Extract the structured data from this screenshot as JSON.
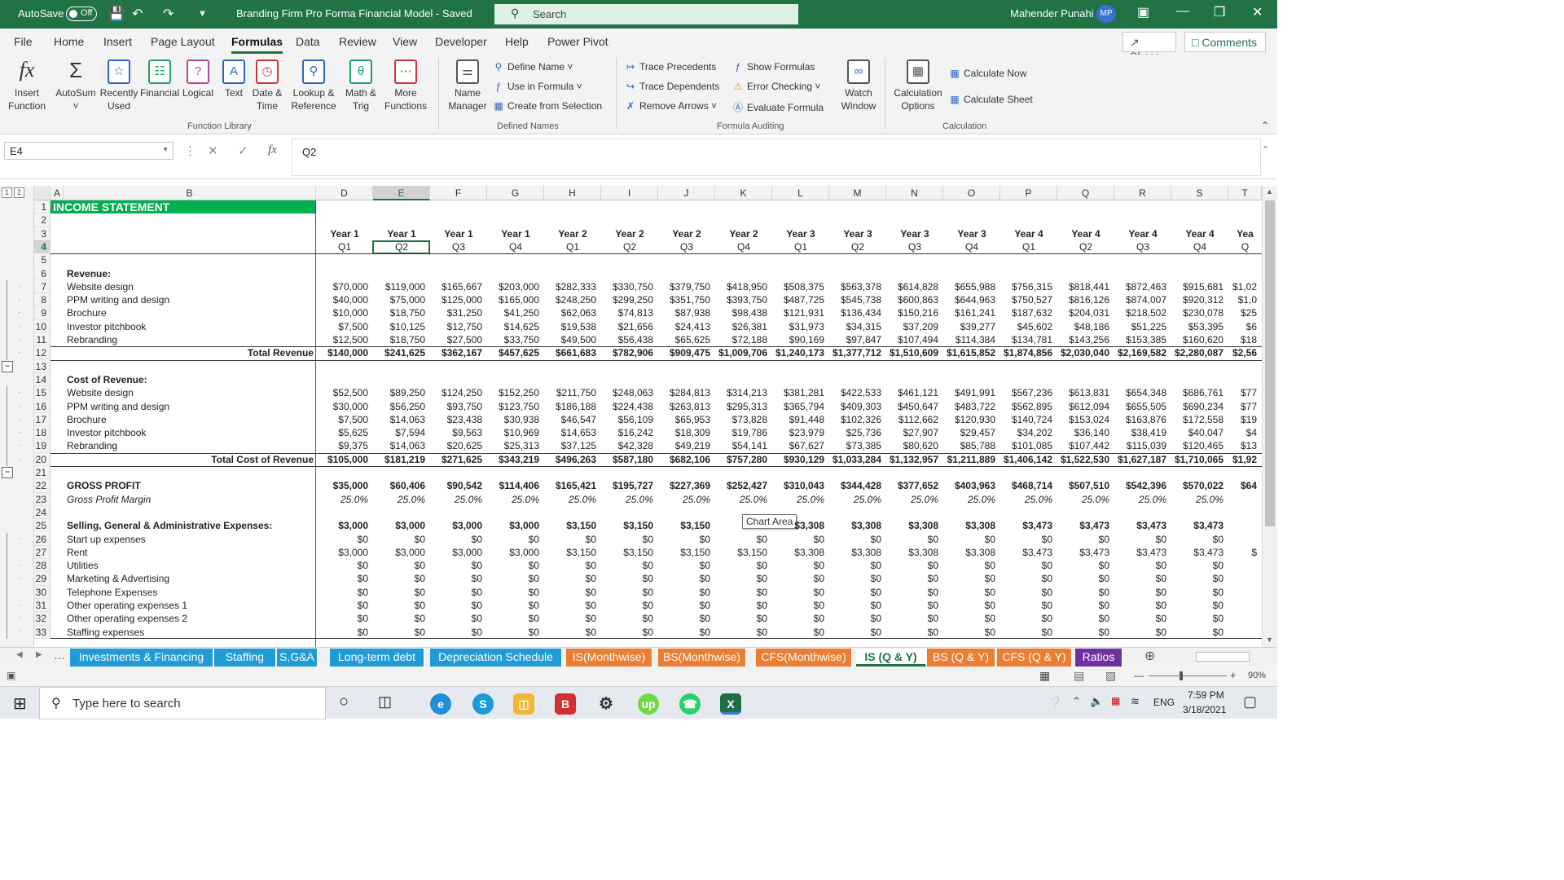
{
  "titlebar": {
    "autosave": "AutoSave",
    "autosave_state": "Off",
    "doc_title": "Branding Firm Pro Forma Financial Model  -  Saved",
    "search": "Search",
    "user": "Mahender Punahi",
    "initials": "MP"
  },
  "menu": [
    "File",
    "Home",
    "Insert",
    "Page Layout",
    "Formulas",
    "Data",
    "Review",
    "View",
    "Developer",
    "Help",
    "Power Pivot"
  ],
  "active_menu": "Formulas",
  "share": "Share",
  "comments": "Comments",
  "ribbon": {
    "insert_function": "Insert Function",
    "autosum": "AutoSum",
    "recently_used": "Recently Used",
    "financial": "Financial",
    "logical": "Logical",
    "text": "Text",
    "date_time": "Date & Time",
    "lookup": "Lookup & Reference",
    "math": "Math & Trig",
    "more": "More Functions",
    "name_manager": "Name Manager",
    "define_name": "Define Name",
    "use_in_formula": "Use in Formula",
    "create_from_selection": "Create from Selection",
    "trace_precedents": "Trace Precedents",
    "trace_dependents": "Trace Dependents",
    "remove_arrows": "Remove Arrows",
    "show_formulas": "Show Formulas",
    "error_checking": "Error Checking",
    "evaluate_formula": "Evaluate Formula",
    "watch_window": "Watch Window",
    "calc_options": "Calculation Options",
    "calc_now": "Calculate Now",
    "calc_sheet": "Calculate Sheet",
    "group_function_library": "Function Library",
    "group_defined_names": "Defined Names",
    "group_formula_auditing": "Formula Auditing",
    "group_calculation": "Calculation"
  },
  "formula_bar": {
    "name_box": "E4",
    "content": "Q2"
  },
  "columns": [
    "A",
    "B",
    "D",
    "E",
    "F",
    "G",
    "H",
    "I",
    "J",
    "K",
    "L",
    "M",
    "N",
    "O",
    "P",
    "Q",
    "R",
    "S",
    "T"
  ],
  "selected_column": "E",
  "outline_levels": [
    "1",
    "2"
  ],
  "sheet": {
    "title": "INCOME STATEMENT",
    "years": [
      "Year 1",
      "Year 1",
      "Year 1",
      "Year 1",
      "Year 2",
      "Year 2",
      "Year 2",
      "Year 2",
      "Year 3",
      "Year 3",
      "Year 3",
      "Year 3",
      "Year 4",
      "Year 4",
      "Year 4",
      "Year 4",
      "Yea"
    ],
    "quarters": [
      "Q1",
      "Q2",
      "Q3",
      "Q4",
      "Q1",
      "Q2",
      "Q3",
      "Q4",
      "Q1",
      "Q2",
      "Q3",
      "Q4",
      "Q1",
      "Q2",
      "Q3",
      "Q4",
      "Q"
    ],
    "rows": [
      {
        "r": "1"
      },
      {
        "r": "2"
      },
      {
        "r": "3"
      },
      {
        "r": "4"
      },
      {
        "r": "5"
      },
      {
        "r": "6",
        "label": "Revenue:",
        "style": "b"
      },
      {
        "r": "7",
        "label": "Website design",
        "vals": [
          "$70,000",
          "$119,000",
          "$165,667",
          "$203,000",
          "$282,333",
          "$330,750",
          "$379,750",
          "$418,950",
          "$508,375",
          "$563,378",
          "$614,828",
          "$655,988",
          "$756,315",
          "$818,441",
          "$872,463",
          "$915,681",
          "$1,02"
        ]
      },
      {
        "r": "8",
        "label": "PPM writing and design",
        "vals": [
          "$40,000",
          "$75,000",
          "$125,000",
          "$165,000",
          "$248,250",
          "$299,250",
          "$351,750",
          "$393,750",
          "$487,725",
          "$545,738",
          "$600,863",
          "$644,963",
          "$750,527",
          "$816,126",
          "$874,007",
          "$920,312",
          "$1,0"
        ]
      },
      {
        "r": "9",
        "label": "Brochure",
        "vals": [
          "$10,000",
          "$18,750",
          "$31,250",
          "$41,250",
          "$62,063",
          "$74,813",
          "$87,938",
          "$98,438",
          "$121,931",
          "$136,434",
          "$150,216",
          "$161,241",
          "$187,632",
          "$204,031",
          "$218,502",
          "$230,078",
          "$25"
        ]
      },
      {
        "r": "10",
        "label": "Investor pitchbook",
        "vals": [
          "$7,500",
          "$10,125",
          "$12,750",
          "$14,625",
          "$19,538",
          "$21,656",
          "$24,413",
          "$26,381",
          "$31,973",
          "$34,315",
          "$37,209",
          "$39,277",
          "$45,602",
          "$48,186",
          "$51,225",
          "$53,395",
          "$6"
        ]
      },
      {
        "r": "11",
        "label": "Rebranding",
        "vals": [
          "$12,500",
          "$18,750",
          "$27,500",
          "$33,750",
          "$49,500",
          "$56,438",
          "$65,625",
          "$72,188",
          "$90,169",
          "$97,847",
          "$107,494",
          "$114,384",
          "$134,781",
          "$143,256",
          "$153,385",
          "$160,620",
          "$18"
        ]
      },
      {
        "r": "12",
        "label": "Total Revenue",
        "style": "total",
        "vals": [
          "$140,000",
          "$241,625",
          "$362,167",
          "$457,625",
          "$661,683",
          "$782,906",
          "$909,475",
          "$1,009,706",
          "$1,240,173",
          "$1,377,712",
          "$1,510,609",
          "$1,615,852",
          "$1,874,856",
          "$2,030,040",
          "$2,169,582",
          "$2,280,087",
          "$2,56"
        ]
      },
      {
        "r": "13"
      },
      {
        "r": "14",
        "label": "Cost of Revenue:",
        "style": "b"
      },
      {
        "r": "15",
        "label": "Website design",
        "vals": [
          "$52,500",
          "$89,250",
          "$124,250",
          "$152,250",
          "$211,750",
          "$248,063",
          "$284,813",
          "$314,213",
          "$381,281",
          "$422,533",
          "$461,121",
          "$491,991",
          "$567,236",
          "$613,831",
          "$654,348",
          "$686,761",
          "$77"
        ]
      },
      {
        "r": "16",
        "label": "PPM writing and design",
        "vals": [
          "$30,000",
          "$56,250",
          "$93,750",
          "$123,750",
          "$186,188",
          "$224,438",
          "$263,813",
          "$295,313",
          "$365,794",
          "$409,303",
          "$450,647",
          "$483,722",
          "$562,895",
          "$612,094",
          "$655,505",
          "$690,234",
          "$77"
        ]
      },
      {
        "r": "17",
        "label": "Brochure",
        "vals": [
          "$7,500",
          "$14,063",
          "$23,438",
          "$30,938",
          "$46,547",
          "$56,109",
          "$65,953",
          "$73,828",
          "$91,448",
          "$102,326",
          "$112,662",
          "$120,930",
          "$140,724",
          "$153,024",
          "$163,876",
          "$172,558",
          "$19"
        ]
      },
      {
        "r": "18",
        "label": "Investor pitchbook",
        "vals": [
          "$5,625",
          "$7,594",
          "$9,563",
          "$10,969",
          "$14,653",
          "$16,242",
          "$18,309",
          "$19,786",
          "$23,979",
          "$25,736",
          "$27,907",
          "$29,457",
          "$34,202",
          "$36,140",
          "$38,419",
          "$40,047",
          "$4"
        ]
      },
      {
        "r": "19",
        "label": "Rebranding",
        "vals": [
          "$9,375",
          "$14,063",
          "$20,625",
          "$25,313",
          "$37,125",
          "$42,328",
          "$49,219",
          "$54,141",
          "$67,627",
          "$73,385",
          "$80,620",
          "$85,788",
          "$101,085",
          "$107,442",
          "$115,039",
          "$120,465",
          "$13"
        ]
      },
      {
        "r": "20",
        "label": "Total Cost of Revenue",
        "style": "total",
        "vals": [
          "$105,000",
          "$181,219",
          "$271,625",
          "$343,219",
          "$496,263",
          "$587,180",
          "$682,106",
          "$757,280",
          "$930,129",
          "$1,033,284",
          "$1,132,957",
          "$1,211,889",
          "$1,406,142",
          "$1,522,530",
          "$1,627,187",
          "$1,710,065",
          "$1,92"
        ]
      },
      {
        "r": "21"
      },
      {
        "r": "22",
        "label": "GROSS PROFIT",
        "style": "b",
        "vals": [
          "$35,000",
          "$60,406",
          "$90,542",
          "$114,406",
          "$165,421",
          "$195,727",
          "$227,369",
          "$252,427",
          "$310,043",
          "$344,428",
          "$377,652",
          "$403,963",
          "$468,714",
          "$507,510",
          "$542,396",
          "$570,022",
          "$64"
        ]
      },
      {
        "r": "23",
        "label": "Gross Profit Margin",
        "style": "i",
        "vals": [
          "25.0%",
          "25.0%",
          "25.0%",
          "25.0%",
          "25.0%",
          "25.0%",
          "25.0%",
          "25.0%",
          "25.0%",
          "25.0%",
          "25.0%",
          "25.0%",
          "25.0%",
          "25.0%",
          "25.0%",
          "25.0%",
          ""
        ]
      },
      {
        "r": "24"
      },
      {
        "r": "25",
        "label": "Selling, General & Administrative Expenses:",
        "style": "b",
        "vals": [
          "$3,000",
          "$3,000",
          "$3,000",
          "$3,000",
          "$3,150",
          "$3,150",
          "$3,150",
          "",
          "$3,308",
          "$3,308",
          "$3,308",
          "$3,308",
          "$3,473",
          "$3,473",
          "$3,473",
          "$3,473",
          ""
        ]
      },
      {
        "r": "26",
        "label": "Start up expenses",
        "vals": [
          "$0",
          "$0",
          "$0",
          "$0",
          "$0",
          "$0",
          "$0",
          "$0",
          "$0",
          "$0",
          "$0",
          "$0",
          "$0",
          "$0",
          "$0",
          "$0",
          ""
        ]
      },
      {
        "r": "27",
        "label": "Rent",
        "vals": [
          "$3,000",
          "$3,000",
          "$3,000",
          "$3,000",
          "$3,150",
          "$3,150",
          "$3,150",
          "$3,150",
          "$3,308",
          "$3,308",
          "$3,308",
          "$3,308",
          "$3,473",
          "$3,473",
          "$3,473",
          "$3,473",
          "$"
        ]
      },
      {
        "r": "28",
        "label": "Utilities",
        "vals": [
          "$0",
          "$0",
          "$0",
          "$0",
          "$0",
          "$0",
          "$0",
          "$0",
          "$0",
          "$0",
          "$0",
          "$0",
          "$0",
          "$0",
          "$0",
          "$0",
          ""
        ]
      },
      {
        "r": "29",
        "label": "Marketing & Advertising",
        "vals": [
          "$0",
          "$0",
          "$0",
          "$0",
          "$0",
          "$0",
          "$0",
          "$0",
          "$0",
          "$0",
          "$0",
          "$0",
          "$0",
          "$0",
          "$0",
          "$0",
          ""
        ]
      },
      {
        "r": "30",
        "label": "Telephone Expenses",
        "vals": [
          "$0",
          "$0",
          "$0",
          "$0",
          "$0",
          "$0",
          "$0",
          "$0",
          "$0",
          "$0",
          "$0",
          "$0",
          "$0",
          "$0",
          "$0",
          "$0",
          ""
        ]
      },
      {
        "r": "31",
        "label": "Other operating expenses 1",
        "vals": [
          "$0",
          "$0",
          "$0",
          "$0",
          "$0",
          "$0",
          "$0",
          "$0",
          "$0",
          "$0",
          "$0",
          "$0",
          "$0",
          "$0",
          "$0",
          "$0",
          ""
        ]
      },
      {
        "r": "32",
        "label": "Other operating expenses  2",
        "vals": [
          "$0",
          "$0",
          "$0",
          "$0",
          "$0",
          "$0",
          "$0",
          "$0",
          "$0",
          "$0",
          "$0",
          "$0",
          "$0",
          "$0",
          "$0",
          "$0",
          ""
        ]
      },
      {
        "r": "33",
        "label": "Staffing expenses",
        "vals": [
          "$0",
          "$0",
          "$0",
          "$0",
          "$0",
          "$0",
          "$0",
          "$0",
          "$0",
          "$0",
          "$0",
          "$0",
          "$0",
          "$0",
          "$0",
          "$0",
          ""
        ]
      }
    ]
  },
  "tooltip": "Chart Area",
  "sheet_tabs": [
    {
      "label": "Investments & Financing",
      "color": "#1f9bd7"
    },
    {
      "label": "Staffing",
      "color": "#1f9bd7"
    },
    {
      "label": "S,G&A",
      "color": "#1f9bd7"
    },
    {
      "label": "Long-term debt",
      "color": "#1f9bd7"
    },
    {
      "label": "Depreciation Schedule",
      "color": "#1f9bd7"
    },
    {
      "label": "IS(Monthwise)",
      "color": "#ed7d31"
    },
    {
      "label": "BS(Monthwise)",
      "color": "#ed7d31"
    },
    {
      "label": "CFS(Monthwise)",
      "color": "#ed7d31"
    },
    {
      "label": "IS (Q & Y)",
      "color": "#ffffff"
    },
    {
      "label": "BS (Q & Y)",
      "color": "#ed7d31"
    },
    {
      "label": "CFS (Q & Y)",
      "color": "#ed7d31"
    },
    {
      "label": "Ratios",
      "color": "#7030a0"
    }
  ],
  "active_sheet": "IS (Q & Y)",
  "status": {
    "zoom": "90%"
  },
  "taskbar": {
    "search": "Type here to search",
    "time": "7:59 PM",
    "date": "3/18/2021",
    "lang": "ENG"
  },
  "colors": {
    "excel_green": "#217346",
    "title_fill": "#00b050"
  }
}
